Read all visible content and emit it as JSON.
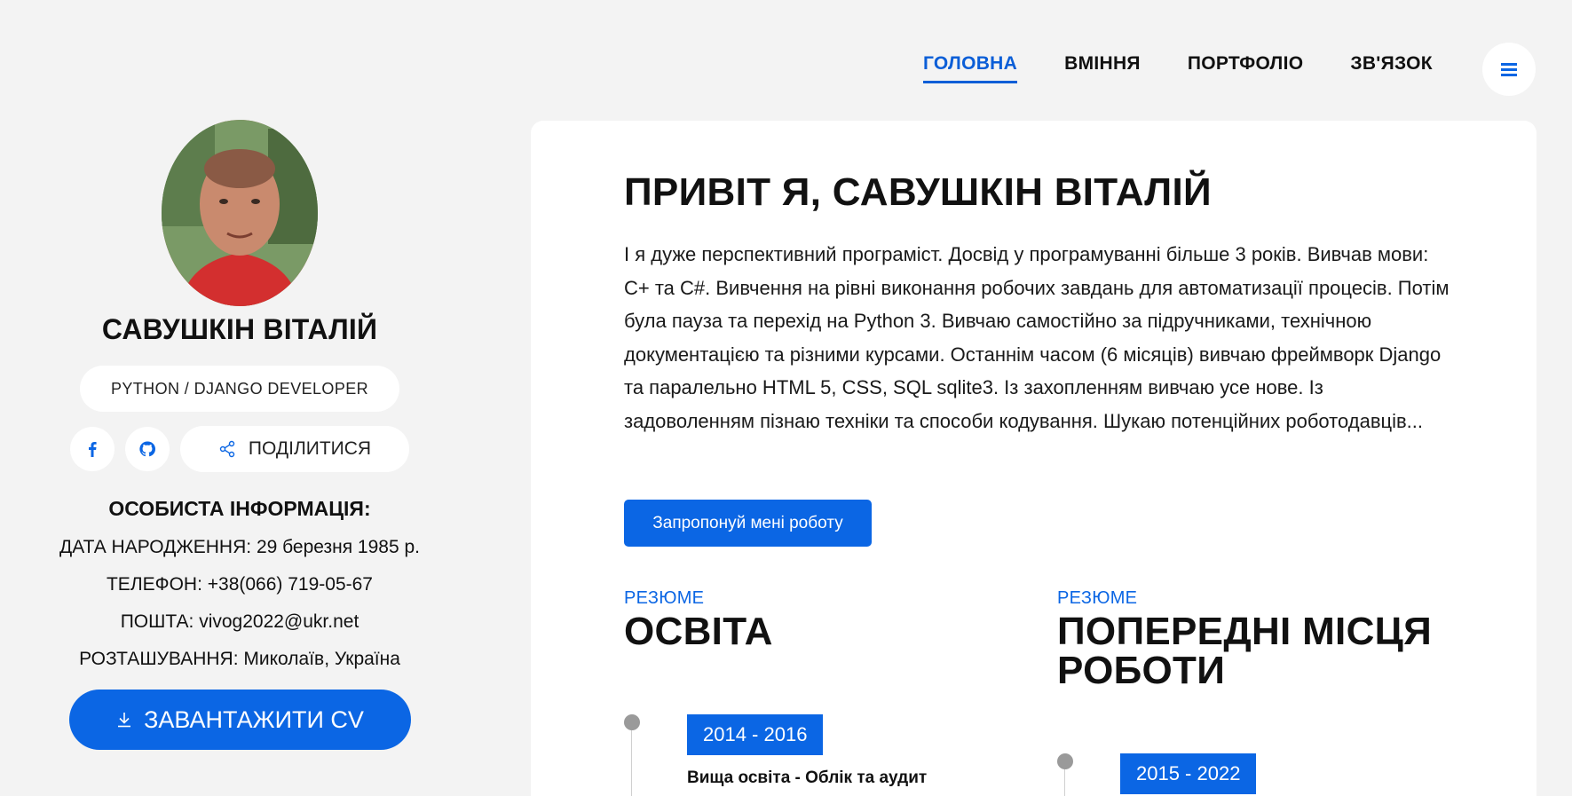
{
  "nav": {
    "items": [
      {
        "label": "ГОЛОВНА",
        "active": true
      },
      {
        "label": "ВМІННЯ",
        "active": false
      },
      {
        "label": "ПОРТФОЛІО",
        "active": false
      },
      {
        "label": "ЗВ'ЯЗОК",
        "active": false
      }
    ],
    "menu_icon": "hamburger-icon"
  },
  "sidebar": {
    "name": "САВУШКІН ВІТАЛІЙ",
    "role": "PYTHON / DJANGO DEVELOPER",
    "social": [
      {
        "icon": "facebook-icon"
      },
      {
        "icon": "github-icon"
      }
    ],
    "share_label": "ПОДІЛИТИСЯ",
    "info_title": "ОСОБИСТА ІНФОРМАЦІЯ:",
    "info": [
      {
        "label": "ДАТА НАРОДЖЕННЯ:",
        "value": "29 березня 1985 р."
      },
      {
        "label": "ТЕЛЕФОН:",
        "value": "+38(066) 719-05-67"
      },
      {
        "label": "ПОШТА:",
        "value": "vivog2022@ukr.net"
      },
      {
        "label": "РОЗТАШУВАННЯ:",
        "value": "Миколаїв, Україна"
      }
    ],
    "download_label": "ЗАВАНТАЖИТИ CV"
  },
  "main": {
    "title": "ПРИВІТ Я, САВУШКІН ВІТАЛІЙ",
    "intro": "І я дуже перспективний програміст. Досвід у програмуванні більше 3 років. Вивчав мови: C+ та C#. Вивчення на рівні виконання робочих завдань для автоматизації процесів. Потім була пауза та перехід на Python 3. Вивчаю самостійно за підручниками, технічною документацією та різними курсами. Останнім часом (6 місяців) вивчаю фреймворк Django та паралельно HTML 5, CSS, SQL sqlite3. Із захопленням вивчаю усе нове. Із задоволенням пізнаю техніки та способи кодування. Шукаю потенційних роботодавців...",
    "cta_label": "Запропонуй мені роботу",
    "education": {
      "kicker": "РЕЗЮМЕ",
      "title": "ОСВІТА",
      "entries": [
        {
          "years": "2014 - 2016",
          "title": "Вища освіта - Облік та аудит"
        }
      ]
    },
    "work": {
      "kicker": "РЕЗЮМЕ",
      "title": "ПОПЕРЕДНІ МІСЦЯ РОБОТИ",
      "entries": [
        {
          "years": "2015 - 2022"
        }
      ]
    }
  },
  "colors": {
    "accent": "#0b66e4",
    "background": "#f3f3f3",
    "card": "#ffffff"
  }
}
